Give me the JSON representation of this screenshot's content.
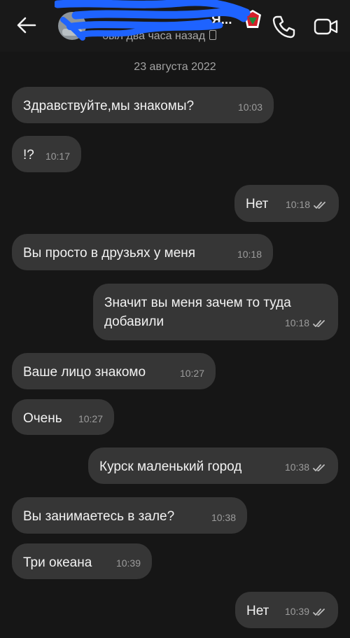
{
  "header": {
    "contact_name": "Я...",
    "status": "был два часа назад",
    "back_icon": "arrow-left-icon",
    "call_icon": "phone-icon",
    "video_icon": "video-camera-icon"
  },
  "date_divider": "23 августа 2022",
  "messages": [
    {
      "direction": "in",
      "text": "Здравствуйте,мы знакомы?",
      "time": "10:03"
    },
    {
      "direction": "in",
      "text": "!?",
      "time": "10:17"
    },
    {
      "direction": "out",
      "text": "Нет",
      "time": "10:18",
      "read": true
    },
    {
      "direction": "in",
      "text": "Вы просто в друзьях у меня",
      "time": "10:18"
    },
    {
      "direction": "out",
      "text": "Значит вы меня зачем то туда добавили",
      "time": "10:18",
      "read": true
    },
    {
      "direction": "in",
      "text": "Ваше лицо знакомо",
      "time": "10:27"
    },
    {
      "direction": "in",
      "text": "Очень",
      "time": "10:27"
    },
    {
      "direction": "out",
      "text": "Курск маленький город",
      "time": "10:38",
      "read": true
    },
    {
      "direction": "in",
      "text": "Вы занимаетесь в зале?",
      "time": "10:38"
    },
    {
      "direction": "in",
      "text": "Три океана",
      "time": "10:39"
    },
    {
      "direction": "out",
      "text": "Нет",
      "time": "10:39",
      "read": true
    }
  ],
  "colors": {
    "background": "#161616",
    "bubble": "#363636",
    "scribble": "#1e63ff"
  }
}
